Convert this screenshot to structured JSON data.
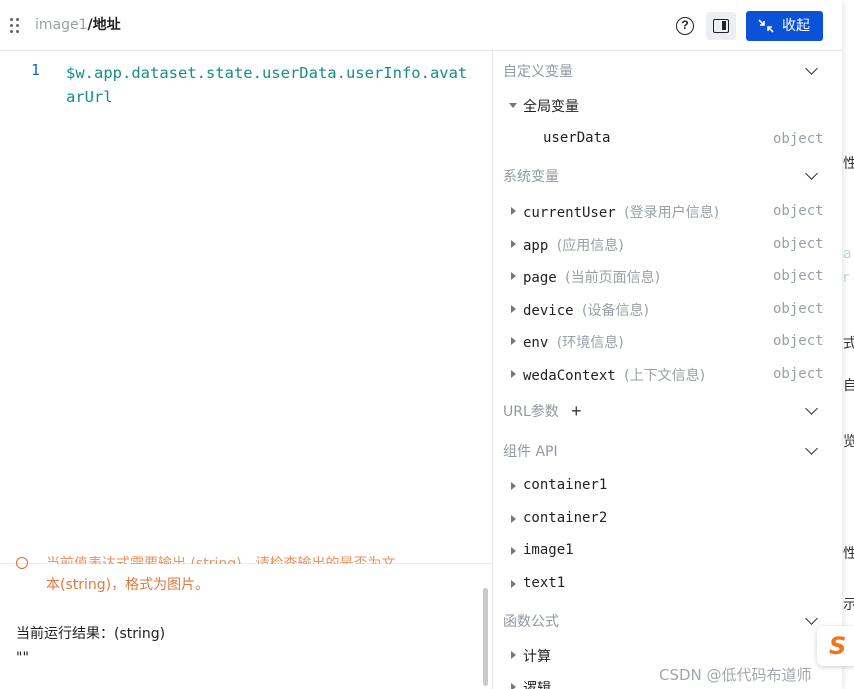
{
  "header": {
    "breadcrumb_parent": "image1",
    "breadcrumb_sep": "/",
    "breadcrumb_current": "地址",
    "help_icon": "question-circle-icon",
    "layout_icon": "side-panel-icon",
    "collapse_label": "收起",
    "collapse_icon": "arrows-inward-icon",
    "accent_color": "#0b52d8"
  },
  "editor": {
    "line_number": "1",
    "code": "$w.app.dataset.state.userData.userInfo.avatarUrl"
  },
  "bottom": {
    "warning_line1": "当前值表达式需要输出 (string)，请检查输出的是否为文",
    "warning_line2": "本(string)，格式为图片。",
    "result_label": "当前运行结果：(string)",
    "result_value": "\"\""
  },
  "vars": {
    "custom": {
      "title": "自定义变量",
      "global_group": "全局变量",
      "items": [
        {
          "name": "userData",
          "type": "object"
        }
      ]
    },
    "system": {
      "title": "系统变量",
      "items": [
        {
          "name": "currentUser",
          "desc": "(登录用户信息)",
          "type": "object"
        },
        {
          "name": "app",
          "desc": "(应用信息)",
          "type": "object"
        },
        {
          "name": "page",
          "desc": "(当前页面信息)",
          "type": "object"
        },
        {
          "name": "device",
          "desc": "(设备信息)",
          "type": "object"
        },
        {
          "name": "env",
          "desc": "(环境信息)",
          "type": "object"
        },
        {
          "name": "wedaContext",
          "desc": "(上下文信息)",
          "type": "object"
        }
      ]
    },
    "url_params": {
      "title": "URL参数"
    },
    "component_api": {
      "title": "组件 API",
      "items": [
        "container1",
        "container2",
        "image1",
        "text1"
      ]
    },
    "functions": {
      "title": "函数公式",
      "items": [
        "计算",
        "逻辑"
      ]
    }
  },
  "background": {
    "fragments": [
      "性",
      "a",
      "r",
      "式",
      "自",
      "览",
      "性",
      "示"
    ]
  },
  "float_widget": {
    "glyph": "S"
  },
  "watermark": "CSDN @低代码布道师"
}
